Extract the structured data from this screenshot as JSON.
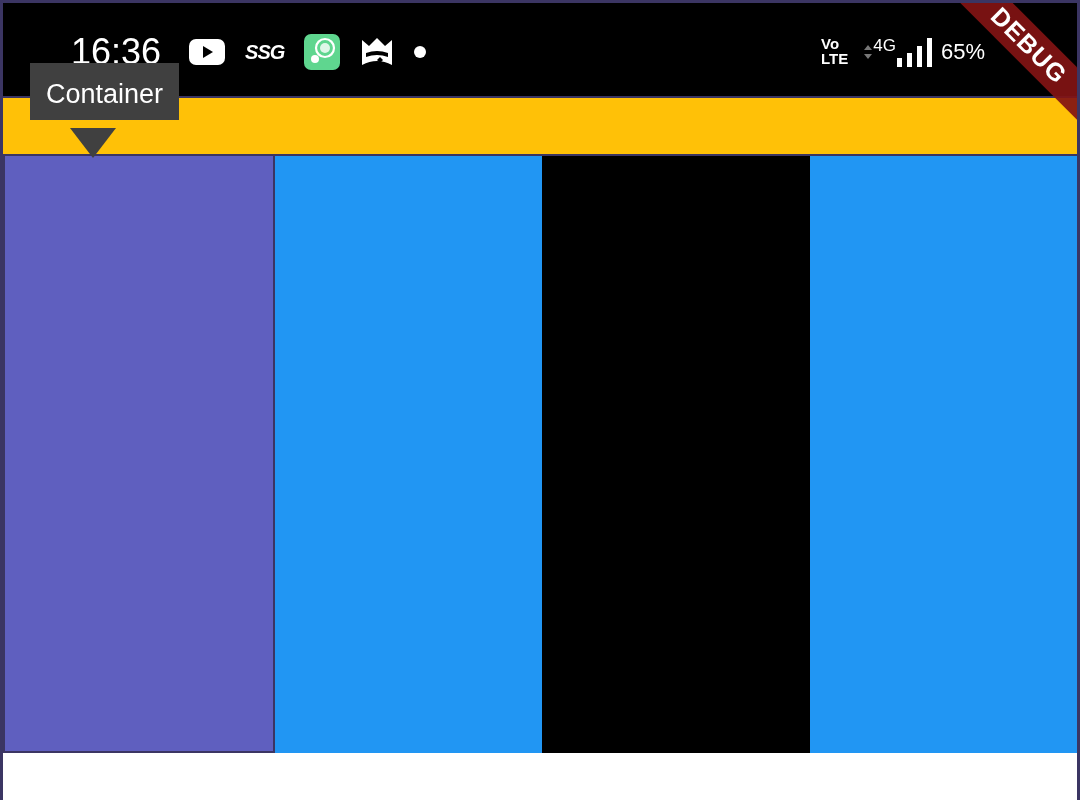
{
  "status_bar": {
    "time": "16:36",
    "notification_text": "SSG",
    "volte_lines": [
      "Vo",
      "LTE"
    ],
    "network": "4G",
    "battery": "65%"
  },
  "app_bar": {
    "color": "#ffc107"
  },
  "columns": [
    {
      "color": "#5f5fbf",
      "selected": true
    },
    {
      "color": "#2196f3",
      "selected": false
    },
    {
      "color": "#000000",
      "selected": false
    },
    {
      "color": "#2196f3",
      "selected": false
    }
  ],
  "tooltip": {
    "text": "Container"
  },
  "debug_banner": {
    "text": "DEBUG"
  }
}
